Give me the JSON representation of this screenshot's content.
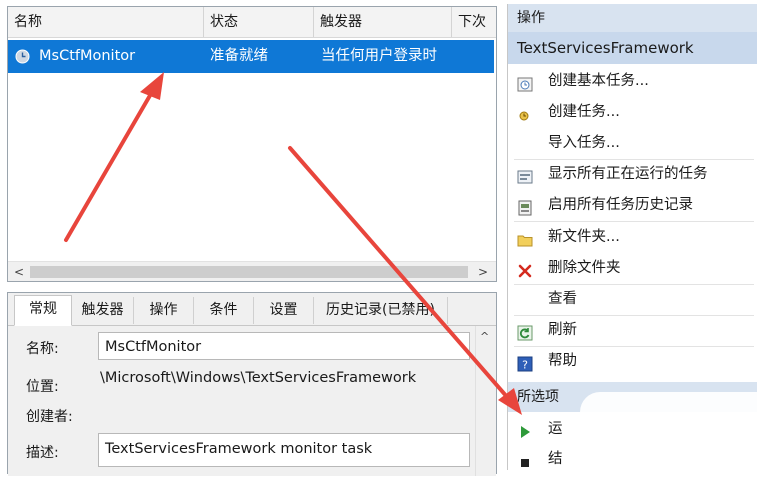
{
  "task_list": {
    "columns": [
      "名称",
      "状态",
      "触发器",
      "下次"
    ],
    "row": {
      "name": "MsCtfMonitor",
      "status": "准备就绪",
      "trigger": "当任何用户登录时"
    },
    "scroll_left": "<",
    "scroll_right": ">"
  },
  "details": {
    "tabs": [
      "常规",
      "触发器",
      "操作",
      "条件",
      "设置",
      "历史记录(已禁用)"
    ],
    "fields": {
      "name_label": "名称:",
      "name_value": "MsCtfMonitor",
      "location_label": "位置:",
      "location_value": "\\Microsoft\\Windows\\TextServicesFramework",
      "author_label": "创建者:",
      "description_label": "描述:",
      "description_value": "TextServicesFramework monitor task"
    },
    "scroll_up": "^"
  },
  "actions": {
    "header": "操作",
    "folder_title": "TextServicesFramework",
    "items": [
      {
        "label": "创建基本任务...",
        "icon": "basic-task-icon"
      },
      {
        "label": "创建任务...",
        "icon": "create-task-icon"
      },
      {
        "label": "导入任务...",
        "icon": ""
      },
      {
        "label": "显示所有正在运行的任务",
        "icon": "running-tasks-icon"
      },
      {
        "label": "启用所有任务历史记录",
        "icon": "history-icon"
      },
      {
        "label": "新文件夹...",
        "icon": "folder-icon"
      },
      {
        "label": "删除文件夹",
        "icon": "delete-icon"
      },
      {
        "label": "查看",
        "icon": ""
      },
      {
        "label": "刷新",
        "icon": "refresh-icon"
      },
      {
        "label": "帮助",
        "icon": "help-icon"
      }
    ],
    "selected_header": "所选项",
    "selected_items": [
      {
        "label": "运",
        "icon": "run-icon"
      },
      {
        "label": "结",
        "icon": "end-icon"
      }
    ]
  },
  "colors": {
    "selection": "#0f78d6",
    "section_header": "#d8e3f0",
    "subheader": "#c8d8ec",
    "arrow": "#e8453c"
  }
}
